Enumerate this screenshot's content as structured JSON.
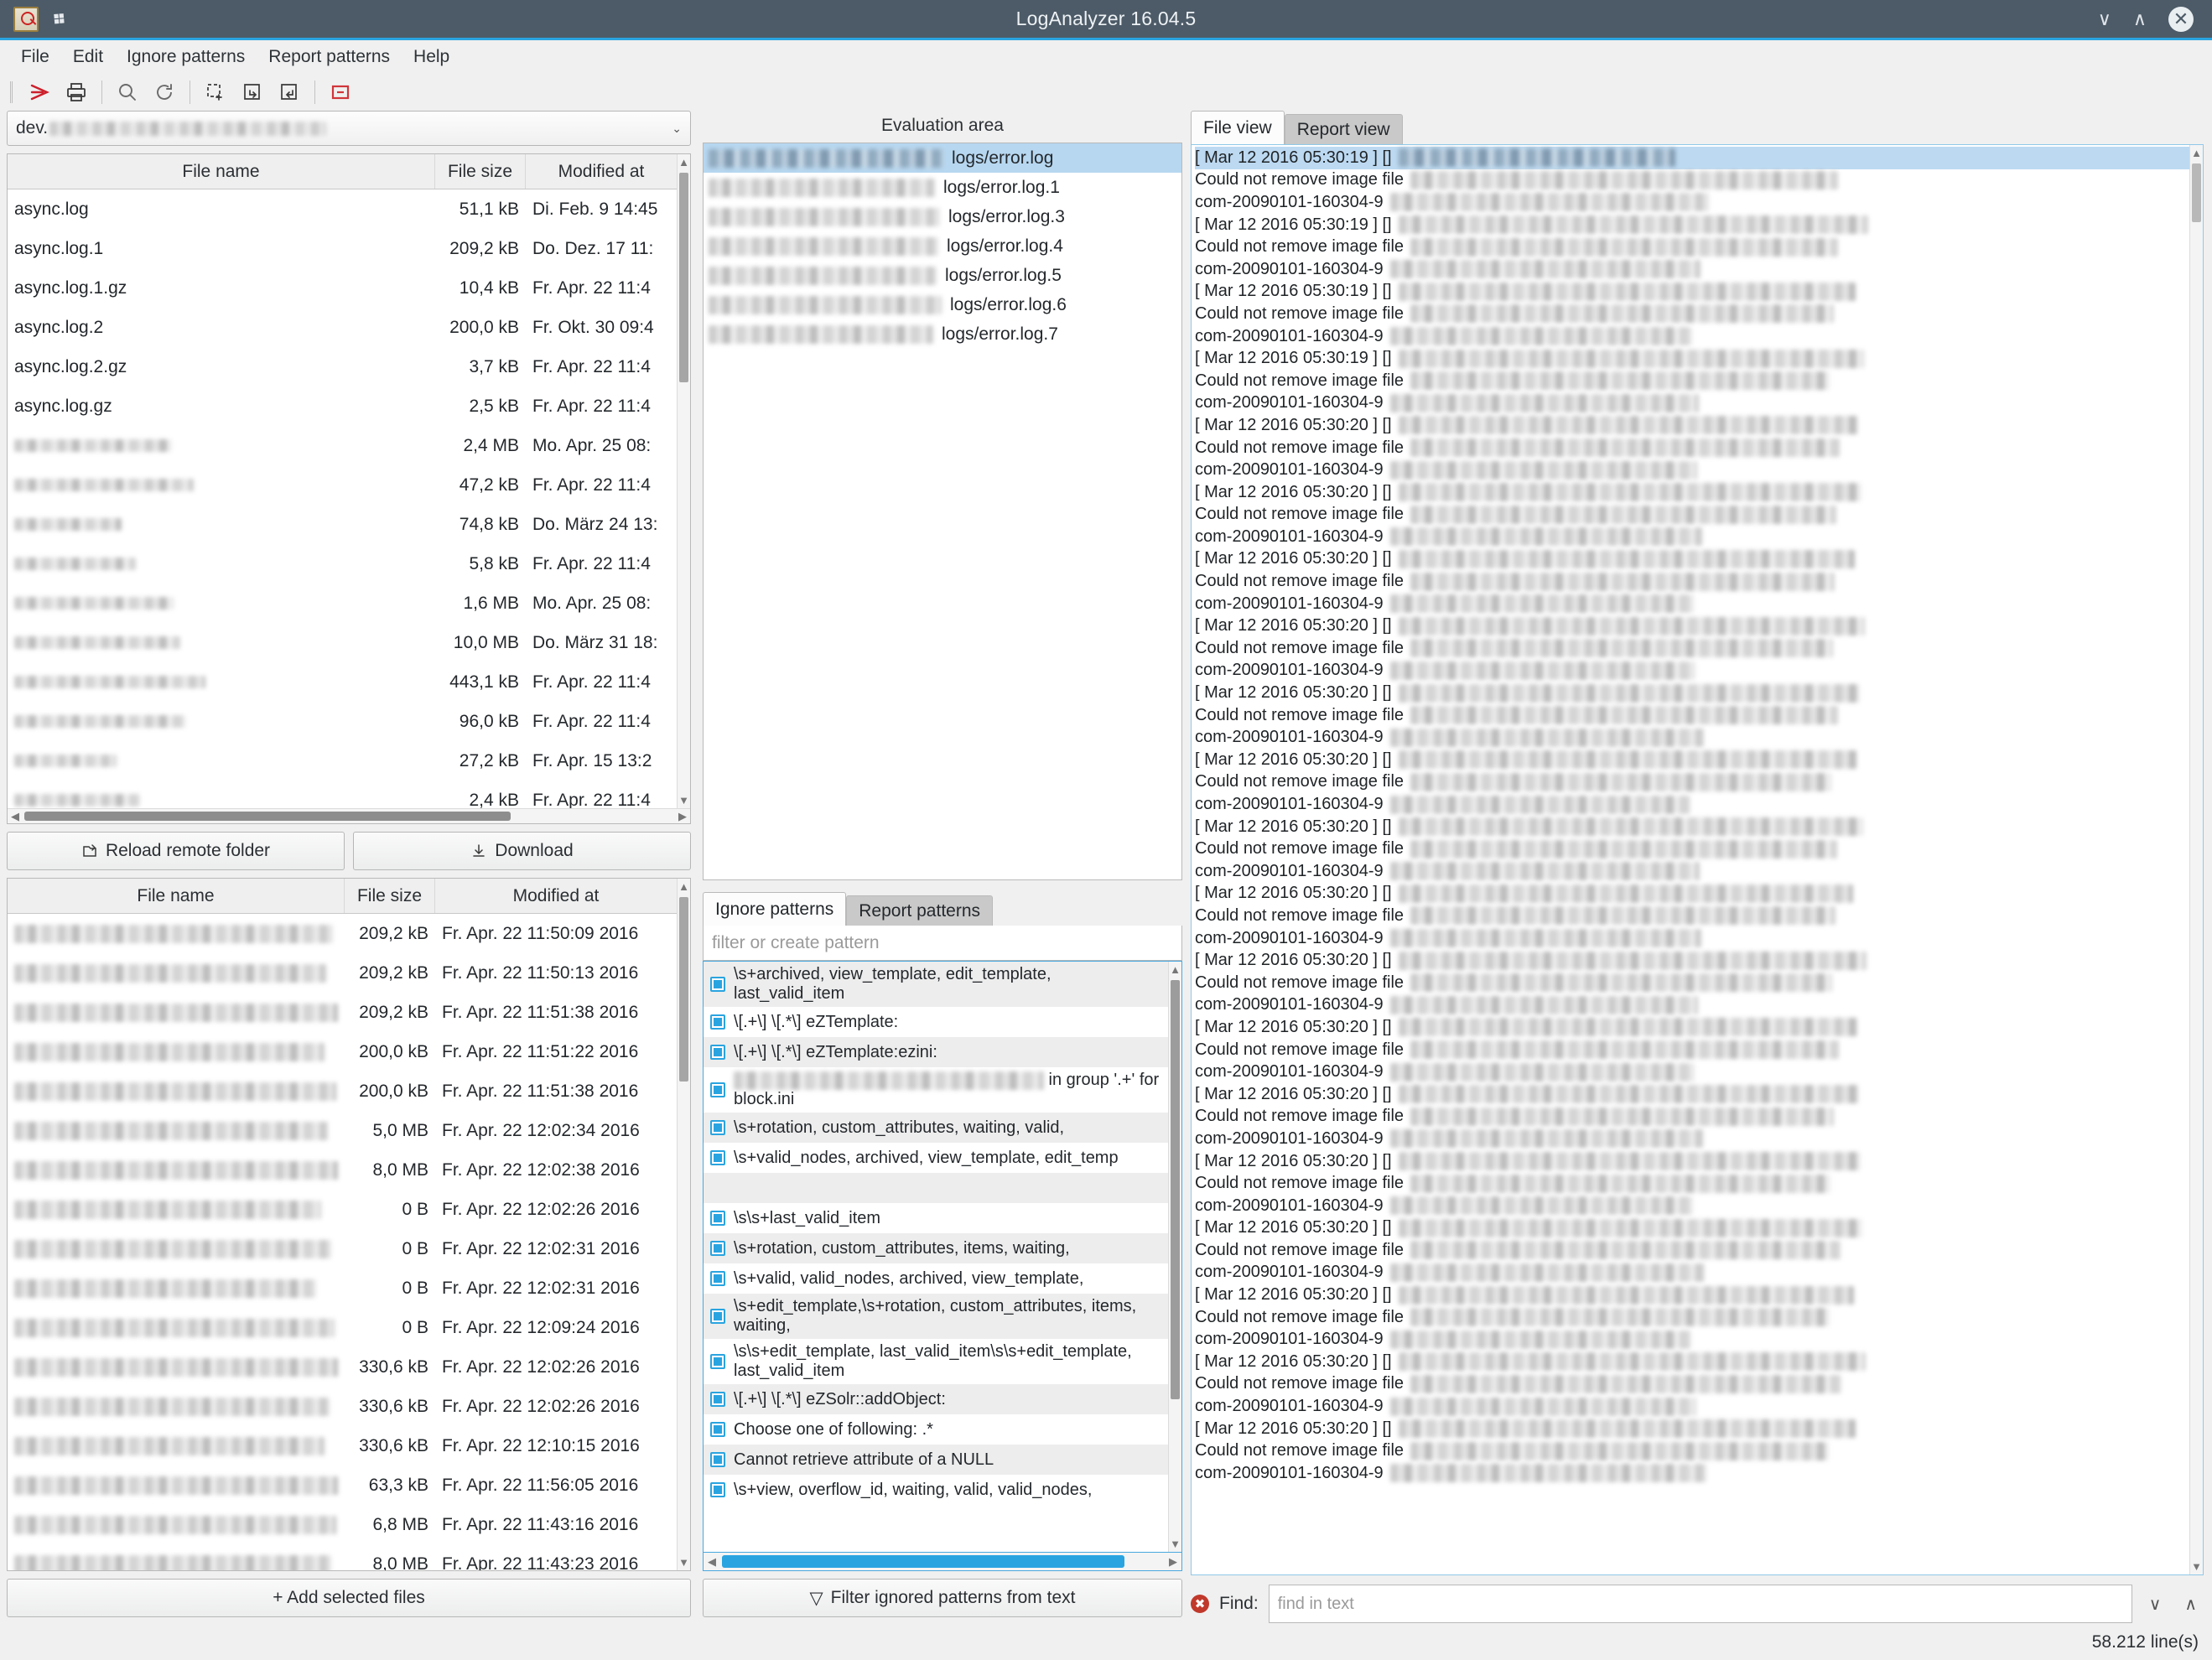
{
  "window": {
    "title": "LogAnalyzer 16.04.5",
    "app_icon": "log-analyzer-icon",
    "pin_icon": "pin-icon",
    "minimize": "∨",
    "maximize": "∧",
    "close": "✕"
  },
  "menu": [
    "File",
    "Edit",
    "Ignore patterns",
    "Report patterns",
    "Help"
  ],
  "toolbar": [
    {
      "name": "export-pdf-icon"
    },
    {
      "name": "print-icon"
    },
    {
      "name": "search-icon"
    },
    {
      "name": "refresh-icon"
    },
    {
      "name": "add-selection-icon"
    },
    {
      "name": "import-icon"
    },
    {
      "name": "export-icon"
    },
    {
      "name": "remove-icon"
    }
  ],
  "path_combo": {
    "prefix": "dev.",
    "arrow": "⌄"
  },
  "remote_table": {
    "headers": [
      "File name",
      "File size",
      "Modified at"
    ],
    "rows": [
      {
        "name": "async.log",
        "redacted": false,
        "size": "51,1 kB",
        "modified": "Di. Feb. 9 14:45"
      },
      {
        "name": "async.log.1",
        "redacted": false,
        "size": "209,2 kB",
        "modified": "Do. Dez. 17 11:"
      },
      {
        "name": "async.log.1.gz",
        "redacted": false,
        "size": "10,4 kB",
        "modified": "Fr. Apr. 22 11:4"
      },
      {
        "name": "async.log.2",
        "redacted": false,
        "size": "200,0 kB",
        "modified": "Fr. Okt. 30 09:4"
      },
      {
        "name": "async.log.2.gz",
        "redacted": false,
        "size": "3,7 kB",
        "modified": "Fr. Apr. 22 11:4"
      },
      {
        "name": "async.log.gz",
        "redacted": false,
        "size": "2,5 kB",
        "modified": "Fr. Apr. 22 11:4"
      },
      {
        "name": "",
        "redacted": true,
        "blur_w": 188,
        "size": "2,4 MB",
        "modified": "Mo. Apr. 25 08:"
      },
      {
        "name": "",
        "redacted": true,
        "blur_w": 214,
        "size": "47,2 kB",
        "modified": "Fr. Apr. 22 11:4"
      },
      {
        "name": "",
        "redacted": true,
        "blur_w": 128,
        "size": "74,8 kB",
        "modified": "Do. März 24 13:"
      },
      {
        "name": "",
        "redacted": true,
        "blur_w": 145,
        "size": "5,8 kB",
        "modified": "Fr. Apr. 22 11:4"
      },
      {
        "name": "",
        "redacted": true,
        "blur_w": 190,
        "size": "1,6 MB",
        "modified": "Mo. Apr. 25 08:"
      },
      {
        "name": "",
        "redacted": true,
        "blur_w": 198,
        "size": "10,0 MB",
        "modified": "Do. März 31 18:"
      },
      {
        "name": "",
        "redacted": true,
        "blur_w": 228,
        "size": "443,1 kB",
        "modified": "Fr. Apr. 22 11:4"
      },
      {
        "name": "",
        "redacted": true,
        "blur_w": 204,
        "size": "96,0 kB",
        "modified": "Fr. Apr. 22 11:4"
      },
      {
        "name": "",
        "redacted": true,
        "blur_w": 122,
        "size": "27,2 kB",
        "modified": "Fr. Apr. 15 13:2"
      },
      {
        "name": "",
        "redacted": true,
        "blur_w": 150,
        "size": "2,4 kB",
        "modified": "Fr. Apr. 22 11:4"
      }
    ]
  },
  "remote_buttons": {
    "reload": "Reload remote folder",
    "reload_icon": "reload-folder-icon",
    "download": "Download",
    "download_icon": "download-icon"
  },
  "local_table": {
    "headers": [
      "File name",
      "File size",
      "Modified at"
    ],
    "rows": [
      {
        "blur_w": 380,
        "size": "209,2 kB",
        "modified": "Fr. Apr. 22 11:50:09 2016"
      },
      {
        "blur_w": 372,
        "size": "209,2 kB",
        "modified": "Fr. Apr. 22 11:50:13 2016"
      },
      {
        "blur_w": 386,
        "size": "209,2 kB",
        "modified": "Fr. Apr. 22 11:51:38 2016"
      },
      {
        "blur_w": 370,
        "size": "200,0 kB",
        "modified": "Fr. Apr. 22 11:51:22 2016"
      },
      {
        "blur_w": 384,
        "size": "200,0 kB",
        "modified": "Fr. Apr. 22 11:51:38 2016"
      },
      {
        "blur_w": 374,
        "size": "5,0 MB",
        "modified": "Fr. Apr. 22 12:02:34 2016"
      },
      {
        "blur_w": 388,
        "size": "8,0 MB",
        "modified": "Fr. Apr. 22 12:02:38 2016"
      },
      {
        "blur_w": 366,
        "size": "0 B",
        "modified": "Fr. Apr. 22 12:02:26 2016"
      },
      {
        "blur_w": 378,
        "size": "0 B",
        "modified": "Fr. Apr. 22 12:02:31 2016"
      },
      {
        "blur_w": 360,
        "size": "0 B",
        "modified": "Fr. Apr. 22 12:02:31 2016"
      },
      {
        "blur_w": 382,
        "size": "0 B",
        "modified": "Fr. Apr. 22 12:09:24 2016"
      },
      {
        "blur_w": 392,
        "size": "330,6 kB",
        "modified": "Fr. Apr. 22 12:02:26 2016"
      },
      {
        "blur_w": 376,
        "size": "330,6 kB",
        "modified": "Fr. Apr. 22 12:02:26 2016"
      },
      {
        "blur_w": 370,
        "size": "330,6 kB",
        "modified": "Fr. Apr. 22 12:10:15 2016"
      },
      {
        "blur_w": 390,
        "size": "63,3 kB",
        "modified": "Fr. Apr. 22 11:56:05 2016"
      },
      {
        "blur_w": 384,
        "size": "6,8 MB",
        "modified": "Fr. Apr. 22 11:43:16 2016"
      },
      {
        "blur_w": 378,
        "size": "8,0 MB",
        "modified": "Fr. Apr. 22 11:43:23 2016"
      }
    ]
  },
  "add_files_button": {
    "label": "+ Add selected files"
  },
  "evaluation": {
    "title": "Evaluation area",
    "items": [
      {
        "path": "logs/error.log",
        "selected": true,
        "blur_w": 280
      },
      {
        "path": "logs/error.log.1",
        "selected": false,
        "blur_w": 270
      },
      {
        "path": "logs/error.log.3",
        "selected": false,
        "blur_w": 276
      },
      {
        "path": "logs/error.log.4",
        "selected": false,
        "blur_w": 274
      },
      {
        "path": "logs/error.log.5",
        "selected": false,
        "blur_w": 272
      },
      {
        "path": "logs/error.log.6",
        "selected": false,
        "blur_w": 278
      },
      {
        "path": "logs/error.log.7",
        "selected": false,
        "blur_w": 268
      }
    ]
  },
  "patterns_panel": {
    "tabs": [
      {
        "label": "Ignore patterns",
        "active": true
      },
      {
        "label": "Report patterns",
        "active": false
      }
    ],
    "filter_placeholder": "filter or create pattern",
    "filter_value": "",
    "items": [
      {
        "text": "\\s+archived, view_template, edit_template, last_valid_item",
        "checked": true,
        "redacted": false
      },
      {
        "text": "\\[.+\\] \\[.*\\] eZTemplate:",
        "checked": true,
        "redacted": false
      },
      {
        "text": "\\[.+\\] \\[.*\\] eZTemplate:ezini:",
        "checked": true,
        "redacted": false
      },
      {
        "text": "in group '.+' for block.ini",
        "checked": true,
        "redacted": true,
        "blur_w": 370
      },
      {
        "text": "\\s+rotation, custom_attributes, waiting, valid,",
        "checked": true,
        "redacted": false
      },
      {
        "text": "\\s+valid_nodes, archived, view_template, edit_temp",
        "checked": true,
        "redacted": false
      },
      {
        "text": "",
        "checked": false,
        "redacted": false,
        "spacer": true
      },
      {
        "text": "\\s\\s+last_valid_item",
        "checked": true,
        "redacted": false
      },
      {
        "text": "\\s+rotation, custom_attributes, items, waiting,",
        "checked": true,
        "redacted": false
      },
      {
        "text": "\\s+valid, valid_nodes, archived, view_template,",
        "checked": true,
        "redacted": false
      },
      {
        "text": "\\s+edit_template,\\s+rotation, custom_attributes, items, waiting,",
        "checked": true,
        "redacted": false
      },
      {
        "text": "\\s\\s+edit_template, last_valid_item\\s\\s+edit_template, last_valid_item",
        "checked": true,
        "redacted": false
      },
      {
        "text": "\\[.+\\] \\[.*\\] eZSolr::addObject:",
        "checked": true,
        "redacted": false
      },
      {
        "text": "Choose one of following: .*",
        "checked": true,
        "redacted": false
      },
      {
        "text": "Cannot retrieve attribute of a NULL",
        "checked": true,
        "redacted": false
      },
      {
        "text": "\\s+view, overflow_id, waiting, valid, valid_nodes,",
        "checked": true,
        "redacted": false
      }
    ],
    "filter_button": {
      "label": "Filter ignored patterns from text",
      "icon": "filter-icon"
    }
  },
  "log_panel": {
    "tabs": [
      {
        "label": "File view",
        "active": true
      },
      {
        "label": "Report view",
        "active": false
      }
    ],
    "lines": [
      {
        "text": "[ Mar 12 2016 05:30:19 ] []",
        "selected": true,
        "blur_w": 330,
        "dark": true
      },
      {
        "text": "Could not remove image file",
        "selected": false,
        "blur_w": 510
      },
      {
        "text": "com-20090101-160304-9",
        "selected": false,
        "blur_w": 380
      },
      {
        "text": "[ Mar 12 2016 05:30:19 ] []",
        "selected": false,
        "blur_w": 560
      },
      {
        "text": "Could not remove image file",
        "selected": false,
        "blur_w": 510
      },
      {
        "text": "com-20090101-160304-9",
        "selected": false,
        "blur_w": 370
      },
      {
        "text": "[ Mar 12 2016 05:30:19 ] []",
        "selected": false,
        "blur_w": 545
      },
      {
        "text": "Could not remove image file",
        "selected": false,
        "blur_w": 505
      },
      {
        "text": "com-20090101-160304-9",
        "selected": false,
        "blur_w": 360
      },
      {
        "text": "[ Mar 12 2016 05:30:19 ] []",
        "selected": false,
        "blur_w": 555
      },
      {
        "text": "Could not remove image file",
        "selected": false,
        "blur_w": 500
      },
      {
        "text": "com-20090101-160304-9",
        "selected": false,
        "blur_w": 368
      },
      {
        "text": "[ Mar 12 2016 05:30:20 ] []",
        "selected": false,
        "blur_w": 548
      },
      {
        "text": "Could not remove image file",
        "selected": false,
        "blur_w": 512
      },
      {
        "text": "com-20090101-160304-9",
        "selected": false,
        "blur_w": 366
      },
      {
        "text": "[ Mar 12 2016 05:30:20 ] []",
        "selected": false,
        "blur_w": 552
      },
      {
        "text": "Could not remove image file",
        "selected": false,
        "blur_w": 508
      },
      {
        "text": "com-20090101-160304-9",
        "selected": false,
        "blur_w": 372
      },
      {
        "text": "[ Mar 12 2016 05:30:20 ] []",
        "selected": false,
        "blur_w": 544
      },
      {
        "text": "Could not remove image file",
        "selected": false,
        "blur_w": 506
      },
      {
        "text": "com-20090101-160304-9",
        "selected": false,
        "blur_w": 362
      },
      {
        "text": "[ Mar 12 2016 05:30:20 ] []",
        "selected": false,
        "blur_w": 556
      },
      {
        "text": "Could not remove image file",
        "selected": false,
        "blur_w": 504
      },
      {
        "text": "com-20090101-160304-9",
        "selected": false,
        "blur_w": 364
      },
      {
        "text": "[ Mar 12 2016 05:30:20 ] []",
        "selected": false,
        "blur_w": 550
      },
      {
        "text": "Could not remove image file",
        "selected": false,
        "blur_w": 510
      },
      {
        "text": "com-20090101-160304-9",
        "selected": false,
        "blur_w": 374
      },
      {
        "text": "[ Mar 12 2016 05:30:20 ] []",
        "selected": false,
        "blur_w": 546
      },
      {
        "text": "Could not remove image file",
        "selected": false,
        "blur_w": 502
      },
      {
        "text": "com-20090101-160304-9",
        "selected": false,
        "blur_w": 358
      },
      {
        "text": "[ Mar 12 2016 05:30:20 ] []",
        "selected": false,
        "blur_w": 554
      },
      {
        "text": "Could not remove image file",
        "selected": false,
        "blur_w": 509
      },
      {
        "text": "com-20090101-160304-9",
        "selected": false,
        "blur_w": 369
      },
      {
        "text": "[ Mar 12 2016 05:30:20 ] []",
        "selected": false,
        "blur_w": 542
      },
      {
        "text": "Could not remove image file",
        "selected": false,
        "blur_w": 507
      },
      {
        "text": "com-20090101-160304-9",
        "selected": false,
        "blur_w": 371
      },
      {
        "text": "[ Mar 12 2016 05:30:20 ] []",
        "selected": false,
        "blur_w": 558
      },
      {
        "text": "Could not remove image file",
        "selected": false,
        "blur_w": 503
      },
      {
        "text": "com-20090101-160304-9",
        "selected": false,
        "blur_w": 367
      },
      {
        "text": "[ Mar 12 2016 05:30:20 ] []",
        "selected": false,
        "blur_w": 547
      },
      {
        "text": "Could not remove image file",
        "selected": false,
        "blur_w": 511
      },
      {
        "text": "com-20090101-160304-9",
        "selected": false,
        "blur_w": 363
      },
      {
        "text": "[ Mar 12 2016 05:30:20 ] []",
        "selected": false,
        "blur_w": 549
      },
      {
        "text": "Could not remove image file",
        "selected": false,
        "blur_w": 505
      },
      {
        "text": "com-20090101-160304-9",
        "selected": false,
        "blur_w": 373
      },
      {
        "text": "[ Mar 12 2016 05:30:20 ] []",
        "selected": false,
        "blur_w": 551
      },
      {
        "text": "Could not remove image file",
        "selected": false,
        "blur_w": 501
      },
      {
        "text": "com-20090101-160304-9",
        "selected": false,
        "blur_w": 361
      },
      {
        "text": "[ Mar 12 2016 05:30:20 ] []",
        "selected": false,
        "blur_w": 553
      },
      {
        "text": "Could not remove image file",
        "selected": false,
        "blur_w": 513
      },
      {
        "text": "com-20090101-160304-9",
        "selected": false,
        "blur_w": 375
      },
      {
        "text": "[ Mar 12 2016 05:30:20 ] []",
        "selected": false,
        "blur_w": 543
      },
      {
        "text": "Could not remove image file",
        "selected": false,
        "blur_w": 500
      },
      {
        "text": "com-20090101-160304-9",
        "selected": false,
        "blur_w": 359
      },
      {
        "text": "[ Mar 12 2016 05:30:20 ] []",
        "selected": false,
        "blur_w": 557
      },
      {
        "text": "Could not remove image file",
        "selected": false,
        "blur_w": 514
      },
      {
        "text": "com-20090101-160304-9",
        "selected": false,
        "blur_w": 365
      },
      {
        "text": "[ Mar 12 2016 05:30:20 ] []",
        "selected": false,
        "blur_w": 545
      },
      {
        "text": "Could not remove image file",
        "selected": false,
        "blur_w": 499
      },
      {
        "text": "com-20090101-160304-9",
        "selected": false,
        "blur_w": 377
      }
    ]
  },
  "find": {
    "label": "Find:",
    "placeholder": "find in text",
    "value": "",
    "error_icon": "error-circle-icon",
    "next_icon": "∨",
    "prev_icon": "∧"
  },
  "status": {
    "lines": "58.212 line(s)"
  },
  "colors": {
    "titlebar": "#4d5b68",
    "accent": "#2aa4e0",
    "selection": "#b7d7f0",
    "error": "#c0392b"
  }
}
